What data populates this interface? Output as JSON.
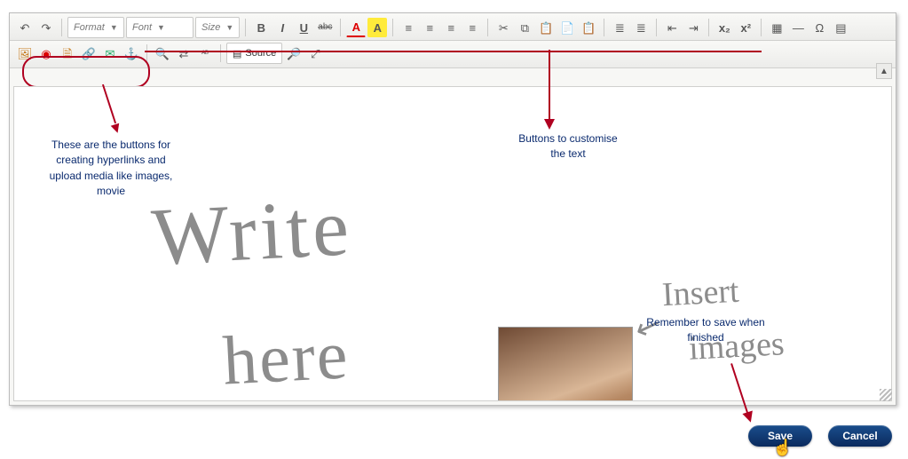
{
  "toolbar": {
    "format_label": "Format",
    "font_label": "Font",
    "size_label": "Size",
    "source_label": "Source"
  },
  "annotations": {
    "left": "These are the buttons for creating hyperlinks and upload media like images, movie",
    "mid": "Buttons to customise the text",
    "save": "Remember to save when finished"
  },
  "handwriting": {
    "l1": "Write",
    "l2": "here",
    "l3": "Insert",
    "l4": "images",
    "arrow": "↙"
  },
  "icons": {
    "undo": "↶",
    "redo": "↷",
    "bold": "B",
    "italic": "I",
    "underline": "U",
    "strike": "abc",
    "textcolor": "A",
    "bgcolor": "A",
    "alignL": "≡",
    "alignC": "≡",
    "alignR": "≡",
    "alignJ": "≡",
    "cut": "✂",
    "copy": "⧉",
    "paste": "📋",
    "pasteT": "📄",
    "pasteW": "📋",
    "ol": "≣",
    "ul": "≣",
    "outdent": "⇤",
    "indent": "⇥",
    "sub": "x₂",
    "sup": "x²",
    "table": "▦",
    "hr": "—",
    "special": "Ω",
    "templates": "▤",
    "image": "🖼",
    "flash": "◉",
    "linkpage": "🗎",
    "linkext": "🔗",
    "linkmail": "✉",
    "anchor": "⚓",
    "find": "🔍",
    "replace": "⇄",
    "spell": "ᴬᴮ",
    "preview": "🔎",
    "maximize": "⤢"
  },
  "buttons": {
    "save": "Save",
    "cancel": "Cancel"
  }
}
